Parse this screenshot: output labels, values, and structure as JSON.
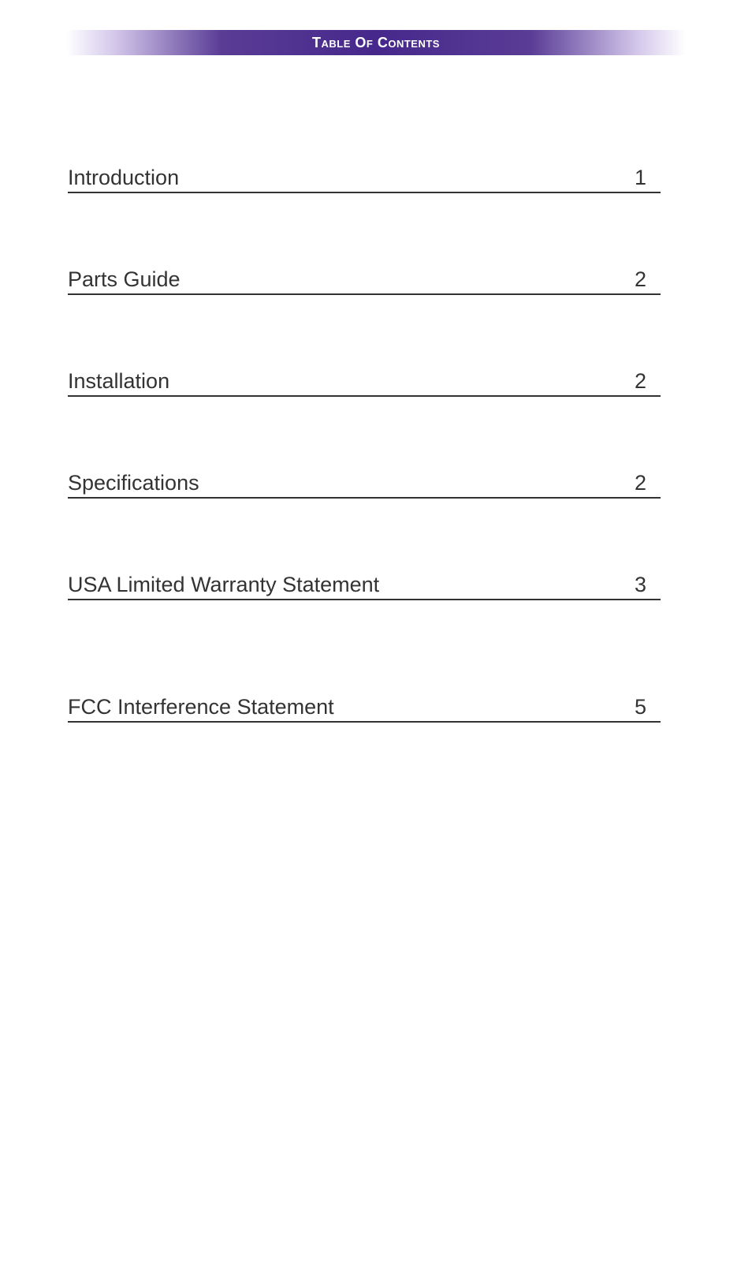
{
  "header": {
    "title": "Table Of Contents"
  },
  "toc": {
    "entries": [
      {
        "title": "Introduction",
        "page": "1"
      },
      {
        "title": "Parts Guide",
        "page": "2"
      },
      {
        "title": "Installation",
        "page": "2"
      },
      {
        "title": "Specifications",
        "page": "2"
      },
      {
        "title": "USA Limited Warranty Statement",
        "page": "3"
      },
      {
        "title": "FCC Interference Statement",
        "page": "5"
      }
    ]
  }
}
